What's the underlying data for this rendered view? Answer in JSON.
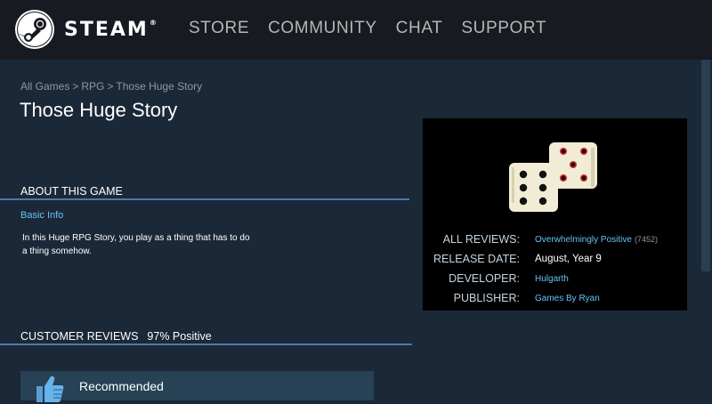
{
  "header": {
    "logo_text": "STEAM",
    "logo_tm": "®",
    "nav": [
      "STORE",
      "COMMUNITY",
      "CHAT",
      "SUPPORT"
    ]
  },
  "breadcrumb": [
    "All Games",
    "RPG",
    "Those Huge Story"
  ],
  "breadcrumb_separator": ">",
  "page_title": "Those Huge Story",
  "about": {
    "heading": "ABOUT THIS GAME",
    "basic_info_link": "Basic Info",
    "description_line1": "In this Huge RPG Story, you play as a thing that has to do",
    "description_line2": "a thing somehow."
  },
  "reviews": {
    "heading": "CUSTOMER REVIEWS",
    "percent": "97% Positive",
    "recommend_label": "Recommended"
  },
  "game_info": {
    "all_reviews_label": "ALL REVIEWS:",
    "all_reviews_value": "Overwhelmingly Positive",
    "all_reviews_count": "(7452)",
    "release_date_label": "RELEASE DATE:",
    "release_date_value": "August, Year 9",
    "developer_label": "DEVELOPER:",
    "developer_value": "Hulgarth",
    "publisher_label": "PUBLISHER:",
    "publisher_value": "Games By Ryan"
  },
  "icons": {
    "logo": "steam-logo-icon",
    "capsule": "dice-icon",
    "recommend": "thumbs-up-icon"
  },
  "colors": {
    "background": "#1b2838",
    "header": "#171a21",
    "link": "#67c1f5",
    "section_line": "#4a7aa6",
    "recommend_bg": "#274155"
  }
}
